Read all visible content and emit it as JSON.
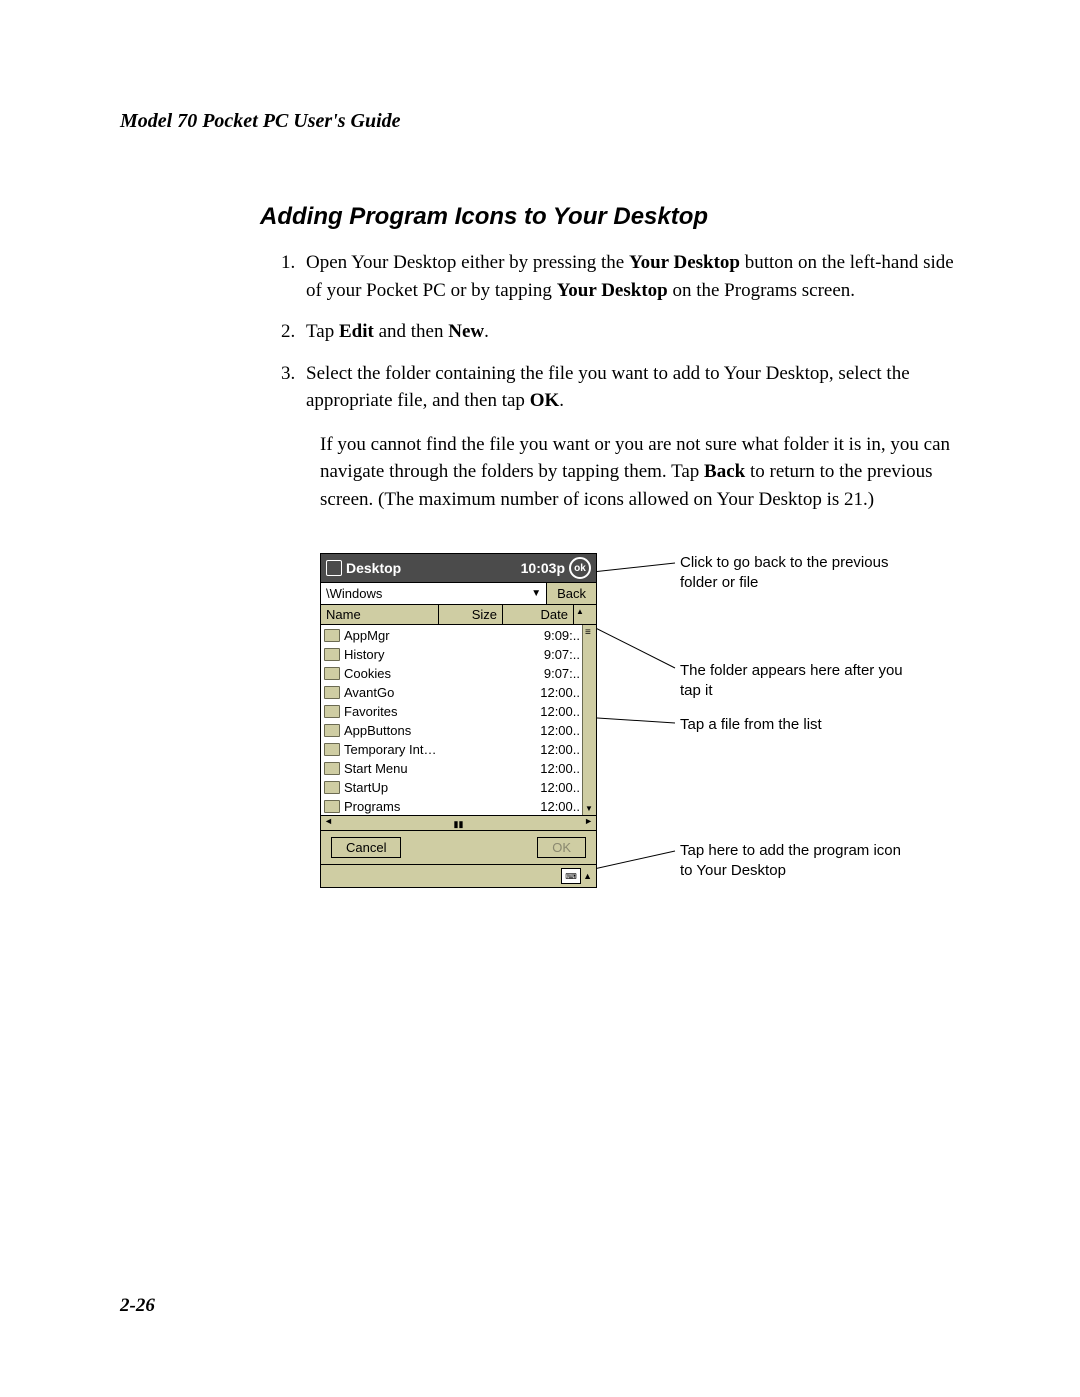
{
  "header": {
    "running_head": "Model 70 Pocket PC User's Guide"
  },
  "section": {
    "title": "Adding Program Icons to Your Desktop",
    "steps": {
      "s1a": "Open Your Desktop either by pressing the ",
      "s1_bold1": "Your Desktop",
      "s1b": " button on the left-hand side of your Pocket PC or by tapping ",
      "s1_bold2": "Your Desktop",
      "s1c": " on the Programs screen.",
      "s2a": "Tap ",
      "s2_bold1": "Edit",
      "s2b": " and then ",
      "s2_bold2": "New",
      "s2c": ".",
      "s3a": "Select the folder containing the file you want to add to Your Desktop, select the appropriate file, and then tap ",
      "s3_bold1": "OK",
      "s3b": "."
    },
    "after": {
      "a": "If you cannot find the file you want or you are not sure what folder it is in, you can navigate through the folders by tapping them. Tap ",
      "bold": "Back",
      "b": " to return to the previous screen. (The maximum number of icons allowed on Your Desktop is 21.)"
    }
  },
  "device": {
    "title": "Desktop",
    "time": "10:03p",
    "ok_badge": "ok",
    "path": "\\Windows",
    "back": "Back",
    "columns": {
      "name": "Name",
      "size": "Size",
      "date": "Date"
    },
    "files": [
      {
        "name": "AppMgr",
        "date": "9:09:.."
      },
      {
        "name": "History",
        "date": "9:07:.."
      },
      {
        "name": "Cookies",
        "date": "9:07:.."
      },
      {
        "name": "AvantGo",
        "date": "12:00.."
      },
      {
        "name": "Favorites",
        "date": "12:00.."
      },
      {
        "name": "AppButtons",
        "date": "12:00.."
      },
      {
        "name": "Temporary Int…",
        "date": "12:00.."
      },
      {
        "name": "Start Menu",
        "date": "12:00.."
      },
      {
        "name": "StartUp",
        "date": "12:00.."
      },
      {
        "name": "Programs",
        "date": "12:00.."
      }
    ],
    "hscroll_thumb": "▮▮",
    "cancel": "Cancel",
    "ok": "OK",
    "kbd": "⌨"
  },
  "callouts": {
    "c1": "Click to go back to the previous folder or file",
    "c2": "The folder appears here after you tap it",
    "c3": "Tap a file from the list",
    "c4": "Tap here to add the program icon to Your Desktop"
  },
  "footer": {
    "page": "2-26"
  }
}
